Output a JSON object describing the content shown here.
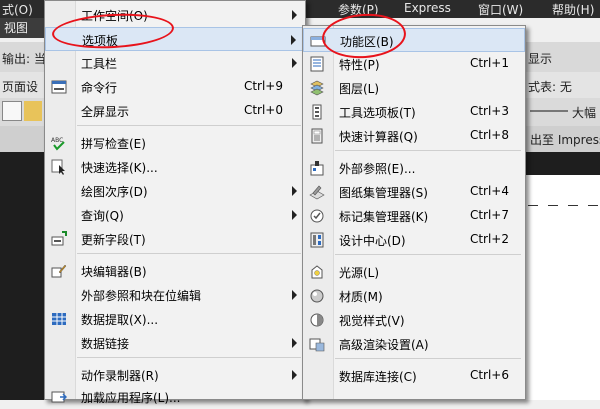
{
  "menubar": {
    "items": [
      "式(O)",
      "参数(P)",
      "Express",
      "窗口(W)",
      "帮助(H)"
    ]
  },
  "background": {
    "view_tab": "视图",
    "output_label": "输出: 当",
    "page_setup_label": "页面设",
    "display_text": "显示",
    "style_table_text": "式表: 无",
    "big_text": "大幅",
    "export_text": "出至 Impress"
  },
  "main_menu": {
    "items": [
      {
        "label": "工作空间(O)",
        "submenu": true
      },
      {
        "label": "选项板",
        "submenu": true,
        "highlighted": true
      },
      {
        "label": "工具栏",
        "submenu": true
      },
      {
        "label": "命令行",
        "shortcut": "Ctrl+9",
        "icon": "command-line-icon"
      },
      {
        "label": "全屏显示",
        "shortcut": "Ctrl+0"
      },
      {
        "label": "拼写检查(E)",
        "icon": "spell-check-icon"
      },
      {
        "label": "快速选择(K)...",
        "icon": "quick-select-icon"
      },
      {
        "label": "绘图次序(D)",
        "submenu": true
      },
      {
        "label": "查询(Q)",
        "submenu": true
      },
      {
        "label": "更新字段(T)",
        "icon": "update-field-icon"
      },
      {
        "label": "块编辑器(B)",
        "icon": "block-editor-icon"
      },
      {
        "label": "外部参照和块在位编辑",
        "submenu": true
      },
      {
        "label": "数据提取(X)...",
        "icon": "data-extract-icon"
      },
      {
        "label": "数据链接",
        "submenu": true
      },
      {
        "label": "动作录制器(R)",
        "submenu": true
      },
      {
        "label": "加载应用程序(L)...",
        "icon": "load-app-icon"
      }
    ]
  },
  "sub_menu": {
    "items": [
      {
        "label": "功能区(B)",
        "icon": "ribbon-icon"
      },
      {
        "label": "特性(P)",
        "shortcut": "Ctrl+1",
        "icon": "properties-icon"
      },
      {
        "label": "图层(L)",
        "icon": "layers-icon"
      },
      {
        "label": "工具选项板(T)",
        "shortcut": "Ctrl+3",
        "icon": "tool-palettes-icon"
      },
      {
        "label": "快速计算器(Q)",
        "shortcut": "Ctrl+8",
        "icon": "calculator-icon"
      },
      {
        "label": "外部参照(E)...",
        "icon": "xref-icon"
      },
      {
        "label": "图纸集管理器(S)",
        "shortcut": "Ctrl+4",
        "icon": "sheet-set-icon"
      },
      {
        "label": "标记集管理器(K)",
        "shortcut": "Ctrl+7",
        "icon": "markup-set-icon"
      },
      {
        "label": "设计中心(D)",
        "shortcut": "Ctrl+2",
        "icon": "design-center-icon"
      },
      {
        "label": "光源(L)",
        "icon": "lights-icon"
      },
      {
        "label": "材质(M)",
        "icon": "materials-icon"
      },
      {
        "label": "视觉样式(V)",
        "icon": "visual-styles-icon"
      },
      {
        "label": "高级渲染设置(A)",
        "icon": "render-settings-icon"
      },
      {
        "label": "数据库连接(C)",
        "shortcut": "Ctrl+6"
      }
    ]
  },
  "colors": {
    "annotation_red": "#e8131b",
    "menu_bg": "#f2f2f2",
    "highlight": "#dbe7f5"
  }
}
